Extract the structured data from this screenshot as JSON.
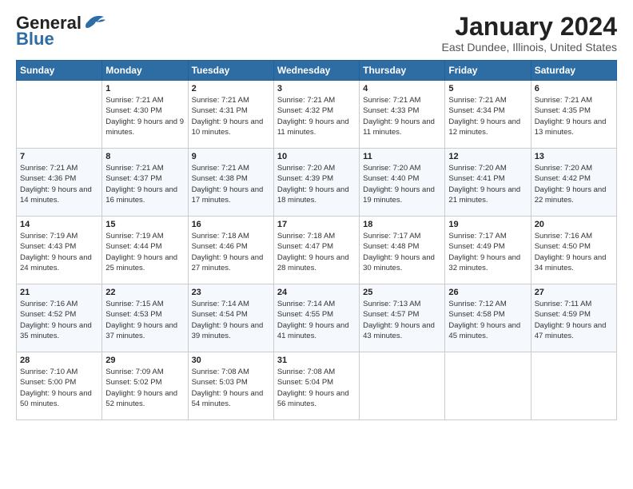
{
  "logo": {
    "line1": "General",
    "line2": "Blue"
  },
  "title": "January 2024",
  "subtitle": "East Dundee, Illinois, United States",
  "days_of_week": [
    "Sunday",
    "Monday",
    "Tuesday",
    "Wednesday",
    "Thursday",
    "Friday",
    "Saturday"
  ],
  "weeks": [
    [
      {
        "day": "",
        "sunrise": "",
        "sunset": "",
        "daylight": ""
      },
      {
        "day": "1",
        "sunrise": "Sunrise: 7:21 AM",
        "sunset": "Sunset: 4:30 PM",
        "daylight": "Daylight: 9 hours and 9 minutes."
      },
      {
        "day": "2",
        "sunrise": "Sunrise: 7:21 AM",
        "sunset": "Sunset: 4:31 PM",
        "daylight": "Daylight: 9 hours and 10 minutes."
      },
      {
        "day": "3",
        "sunrise": "Sunrise: 7:21 AM",
        "sunset": "Sunset: 4:32 PM",
        "daylight": "Daylight: 9 hours and 11 minutes."
      },
      {
        "day": "4",
        "sunrise": "Sunrise: 7:21 AM",
        "sunset": "Sunset: 4:33 PM",
        "daylight": "Daylight: 9 hours and 11 minutes."
      },
      {
        "day": "5",
        "sunrise": "Sunrise: 7:21 AM",
        "sunset": "Sunset: 4:34 PM",
        "daylight": "Daylight: 9 hours and 12 minutes."
      },
      {
        "day": "6",
        "sunrise": "Sunrise: 7:21 AM",
        "sunset": "Sunset: 4:35 PM",
        "daylight": "Daylight: 9 hours and 13 minutes."
      }
    ],
    [
      {
        "day": "7",
        "sunrise": "Sunrise: 7:21 AM",
        "sunset": "Sunset: 4:36 PM",
        "daylight": "Daylight: 9 hours and 14 minutes."
      },
      {
        "day": "8",
        "sunrise": "Sunrise: 7:21 AM",
        "sunset": "Sunset: 4:37 PM",
        "daylight": "Daylight: 9 hours and 16 minutes."
      },
      {
        "day": "9",
        "sunrise": "Sunrise: 7:21 AM",
        "sunset": "Sunset: 4:38 PM",
        "daylight": "Daylight: 9 hours and 17 minutes."
      },
      {
        "day": "10",
        "sunrise": "Sunrise: 7:20 AM",
        "sunset": "Sunset: 4:39 PM",
        "daylight": "Daylight: 9 hours and 18 minutes."
      },
      {
        "day": "11",
        "sunrise": "Sunrise: 7:20 AM",
        "sunset": "Sunset: 4:40 PM",
        "daylight": "Daylight: 9 hours and 19 minutes."
      },
      {
        "day": "12",
        "sunrise": "Sunrise: 7:20 AM",
        "sunset": "Sunset: 4:41 PM",
        "daylight": "Daylight: 9 hours and 21 minutes."
      },
      {
        "day": "13",
        "sunrise": "Sunrise: 7:20 AM",
        "sunset": "Sunset: 4:42 PM",
        "daylight": "Daylight: 9 hours and 22 minutes."
      }
    ],
    [
      {
        "day": "14",
        "sunrise": "Sunrise: 7:19 AM",
        "sunset": "Sunset: 4:43 PM",
        "daylight": "Daylight: 9 hours and 24 minutes."
      },
      {
        "day": "15",
        "sunrise": "Sunrise: 7:19 AM",
        "sunset": "Sunset: 4:44 PM",
        "daylight": "Daylight: 9 hours and 25 minutes."
      },
      {
        "day": "16",
        "sunrise": "Sunrise: 7:18 AM",
        "sunset": "Sunset: 4:46 PM",
        "daylight": "Daylight: 9 hours and 27 minutes."
      },
      {
        "day": "17",
        "sunrise": "Sunrise: 7:18 AM",
        "sunset": "Sunset: 4:47 PM",
        "daylight": "Daylight: 9 hours and 28 minutes."
      },
      {
        "day": "18",
        "sunrise": "Sunrise: 7:17 AM",
        "sunset": "Sunset: 4:48 PM",
        "daylight": "Daylight: 9 hours and 30 minutes."
      },
      {
        "day": "19",
        "sunrise": "Sunrise: 7:17 AM",
        "sunset": "Sunset: 4:49 PM",
        "daylight": "Daylight: 9 hours and 32 minutes."
      },
      {
        "day": "20",
        "sunrise": "Sunrise: 7:16 AM",
        "sunset": "Sunset: 4:50 PM",
        "daylight": "Daylight: 9 hours and 34 minutes."
      }
    ],
    [
      {
        "day": "21",
        "sunrise": "Sunrise: 7:16 AM",
        "sunset": "Sunset: 4:52 PM",
        "daylight": "Daylight: 9 hours and 35 minutes."
      },
      {
        "day": "22",
        "sunrise": "Sunrise: 7:15 AM",
        "sunset": "Sunset: 4:53 PM",
        "daylight": "Daylight: 9 hours and 37 minutes."
      },
      {
        "day": "23",
        "sunrise": "Sunrise: 7:14 AM",
        "sunset": "Sunset: 4:54 PM",
        "daylight": "Daylight: 9 hours and 39 minutes."
      },
      {
        "day": "24",
        "sunrise": "Sunrise: 7:14 AM",
        "sunset": "Sunset: 4:55 PM",
        "daylight": "Daylight: 9 hours and 41 minutes."
      },
      {
        "day": "25",
        "sunrise": "Sunrise: 7:13 AM",
        "sunset": "Sunset: 4:57 PM",
        "daylight": "Daylight: 9 hours and 43 minutes."
      },
      {
        "day": "26",
        "sunrise": "Sunrise: 7:12 AM",
        "sunset": "Sunset: 4:58 PM",
        "daylight": "Daylight: 9 hours and 45 minutes."
      },
      {
        "day": "27",
        "sunrise": "Sunrise: 7:11 AM",
        "sunset": "Sunset: 4:59 PM",
        "daylight": "Daylight: 9 hours and 47 minutes."
      }
    ],
    [
      {
        "day": "28",
        "sunrise": "Sunrise: 7:10 AM",
        "sunset": "Sunset: 5:00 PM",
        "daylight": "Daylight: 9 hours and 50 minutes."
      },
      {
        "day": "29",
        "sunrise": "Sunrise: 7:09 AM",
        "sunset": "Sunset: 5:02 PM",
        "daylight": "Daylight: 9 hours and 52 minutes."
      },
      {
        "day": "30",
        "sunrise": "Sunrise: 7:08 AM",
        "sunset": "Sunset: 5:03 PM",
        "daylight": "Daylight: 9 hours and 54 minutes."
      },
      {
        "day": "31",
        "sunrise": "Sunrise: 7:08 AM",
        "sunset": "Sunset: 5:04 PM",
        "daylight": "Daylight: 9 hours and 56 minutes."
      },
      {
        "day": "",
        "sunrise": "",
        "sunset": "",
        "daylight": ""
      },
      {
        "day": "",
        "sunrise": "",
        "sunset": "",
        "daylight": ""
      },
      {
        "day": "",
        "sunrise": "",
        "sunset": "",
        "daylight": ""
      }
    ]
  ]
}
